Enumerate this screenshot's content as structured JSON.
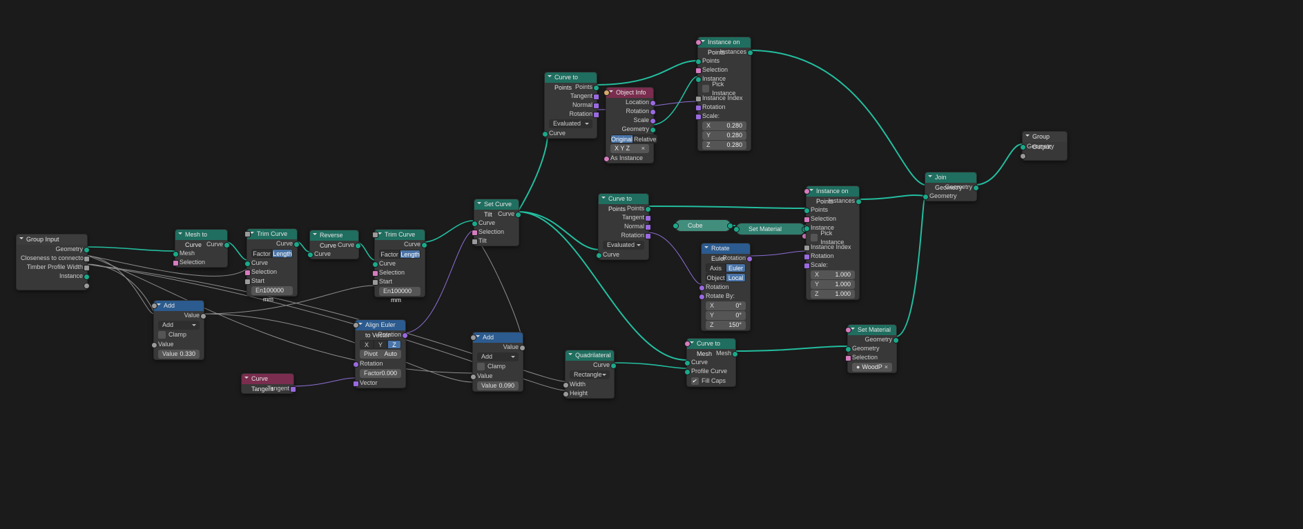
{
  "nodes": {
    "group_input": {
      "title": "Group Input",
      "outs": [
        "Geometry",
        "Closeness to connector",
        "Timber Profile Width",
        "Instance"
      ]
    },
    "add1": {
      "title": "Add",
      "out": "Value",
      "drop": "Add",
      "clamp": "Clamp",
      "val_lbl": "Value",
      "val": "0.330",
      "val2_lbl": "Value"
    },
    "mesh_to_curve": {
      "title": "Mesh to Curve",
      "out": "Curve",
      "ins": [
        "Mesh",
        "Selection"
      ]
    },
    "trim1": {
      "title": "Trim Curve",
      "out": "Curve",
      "mode": [
        "Factor",
        "Length"
      ],
      "ins": [
        "Curve",
        "Selection",
        "Start"
      ],
      "end_u": "En",
      "end_v": "100000 mm"
    },
    "reverse": {
      "title": "Reverse Curve",
      "out": "Curve",
      "in": "Curve"
    },
    "trim2": {
      "title": "Trim Curve",
      "out": "Curve",
      "mode": [
        "Factor",
        "Length"
      ],
      "ins": [
        "Curve",
        "Selection",
        "Start"
      ],
      "end_u": "En",
      "end_v": "100000 mm"
    },
    "set_tilt": {
      "title": "Set Curve Tilt",
      "out": "Curve",
      "ins": [
        "Curve",
        "Selection",
        "Tilt"
      ]
    },
    "align_euler": {
      "title": "Align Euler to Vector",
      "out": "Rotation",
      "axis": [
        "X",
        "Y",
        "Z"
      ],
      "pivot_lbl": "Pivot",
      "pivot": "Auto",
      "rot": "Rotation",
      "factor_lbl": "Factor",
      "factor": "0.000",
      "vec": "Vector"
    },
    "curve_tangent": {
      "title": "Curve Tangent",
      "out": "Tangent"
    },
    "add2": {
      "title": "Add",
      "out": "Value",
      "drop": "Add",
      "clamp": "Clamp",
      "val_lbl": "Value",
      "val": "0.090",
      "val2_lbl": "Value"
    },
    "ctp1": {
      "title": "Curve to Points",
      "outs": [
        "Points",
        "Tangent",
        "Normal",
        "Rotation"
      ],
      "mode": "Evaluated",
      "in": "Curve"
    },
    "obj_info": {
      "title": "Object Info",
      "outs": [
        "Location",
        "Rotation",
        "Scale",
        "Geometry"
      ],
      "space": [
        "Original",
        "Relative"
      ],
      "obj": "X Y Z",
      "as_inst": "As Instance"
    },
    "ctp2": {
      "title": "Curve to Points",
      "outs": [
        "Points",
        "Tangent",
        "Normal",
        "Rotation"
      ],
      "mode": "Evaluated",
      "in": "Curve"
    },
    "rot_euler": {
      "title": "Rotate Euler",
      "out": "Rotation",
      "modeA": [
        "Axis Angle",
        "Euler"
      ],
      "modeB": [
        "Object",
        "Local"
      ],
      "rot": "Rotation",
      "by": "Rotate By:",
      "x": "0°",
      "y": "0°",
      "z": "150°"
    },
    "iop1": {
      "title": "Instance on Points",
      "out": "Instances",
      "ins": [
        "Points",
        "Selection",
        "Instance",
        "Pick Instance",
        "Instance Index",
        "Rotation",
        "Scale:"
      ],
      "sx": "0.280",
      "sy": "0.280",
      "sz": "0.280"
    },
    "iop2": {
      "title": "Instance on Points",
      "out": "Instances",
      "ins": [
        "Points",
        "Selection",
        "Instance",
        "Pick Instance",
        "Instance Index",
        "Rotation",
        "Scale:"
      ],
      "sx": "1.000",
      "sy": "1.000",
      "sz": "1.000"
    },
    "curve_to_mesh": {
      "title": "Curve to Mesh",
      "out": "Mesh",
      "ins": [
        "Curve",
        "Profile Curve"
      ],
      "fill": "Fill Caps"
    },
    "quad": {
      "title": "Quadrilateral",
      "out": "Curve",
      "mode": "Rectangle",
      "ins": [
        "Width",
        "Height"
      ]
    },
    "set_mat_mini": {
      "title": "Set Material"
    },
    "cube_mini": {
      "title": "Cube"
    },
    "set_mat2": {
      "title": "Set Material",
      "out": "Geometry",
      "ins": [
        "Geometry",
        "Selection"
      ],
      "mat": "WoodP"
    },
    "join": {
      "title": "Join Geometry",
      "out": "Geometry",
      "in": "Geometry"
    },
    "group_output": {
      "title": "Group Output",
      "in": "Geometry"
    }
  }
}
